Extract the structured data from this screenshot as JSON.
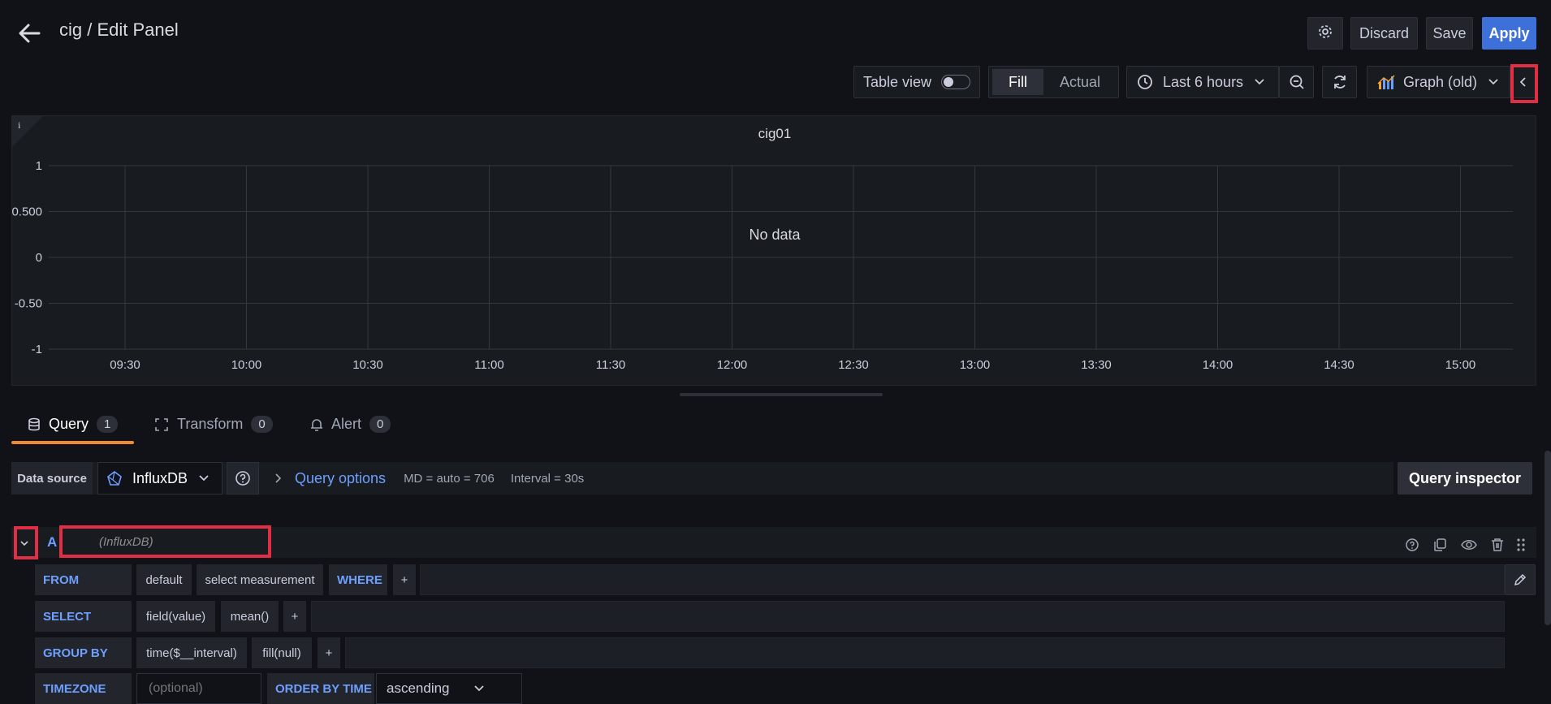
{
  "header": {
    "title": "cig / Edit Panel",
    "discard_label": "Discard",
    "save_label": "Save",
    "apply_label": "Apply"
  },
  "toolbar": {
    "table_view_label": "Table view",
    "fill_label": "Fill",
    "actual_label": "Actual",
    "time_range_label": "Last 6 hours",
    "visualization_label": "Graph (old)"
  },
  "panel": {
    "info_glyph": "i",
    "no_data_label": "No data"
  },
  "chart_data": {
    "type": "line",
    "title": "cig01",
    "x": [
      "09:30",
      "10:00",
      "10:30",
      "11:00",
      "11:30",
      "12:00",
      "12:30",
      "13:00",
      "13:30",
      "14:00",
      "14:30",
      "15:00"
    ],
    "y_ticks": [
      "1",
      "0.500",
      "0",
      "-0.50",
      "-1"
    ],
    "ylim": [
      -1,
      1
    ],
    "series": [],
    "grid": true
  },
  "tabs": [
    {
      "label": "Query",
      "count": "1"
    },
    {
      "label": "Transform",
      "count": "0"
    },
    {
      "label": "Alert",
      "count": "0"
    }
  ],
  "datasource": {
    "label": "Data source",
    "value": "InfluxDB",
    "query_options_label": "Query options",
    "md_text": "MD = auto = 706",
    "interval_text": "Interval = 30s",
    "inspector_label": "Query inspector"
  },
  "query": {
    "ref_id": "A",
    "ds_name": "(InfluxDB)",
    "from": {
      "keyword": "FROM",
      "policy": "default",
      "measurement": "select measurement",
      "where_keyword": "WHERE",
      "add": "+"
    },
    "select": {
      "keyword": "SELECT",
      "field": "field(value)",
      "agg": "mean()",
      "add": "+"
    },
    "group_by": {
      "keyword": "GROUP BY",
      "time": "time($__interval)",
      "fill": "fill(null)",
      "add": "+"
    },
    "timezone": {
      "keyword": "TIMEZONE",
      "placeholder": "(optional)",
      "order_keyword": "ORDER BY TIME",
      "order_value": "ascending"
    }
  },
  "colors": {
    "background": "#111217",
    "panel": "#181b1f",
    "accent": "#3d71d9",
    "keyword": "#6e9fff",
    "tab_underline": "#f08b31",
    "highlight": "#e02f44"
  }
}
